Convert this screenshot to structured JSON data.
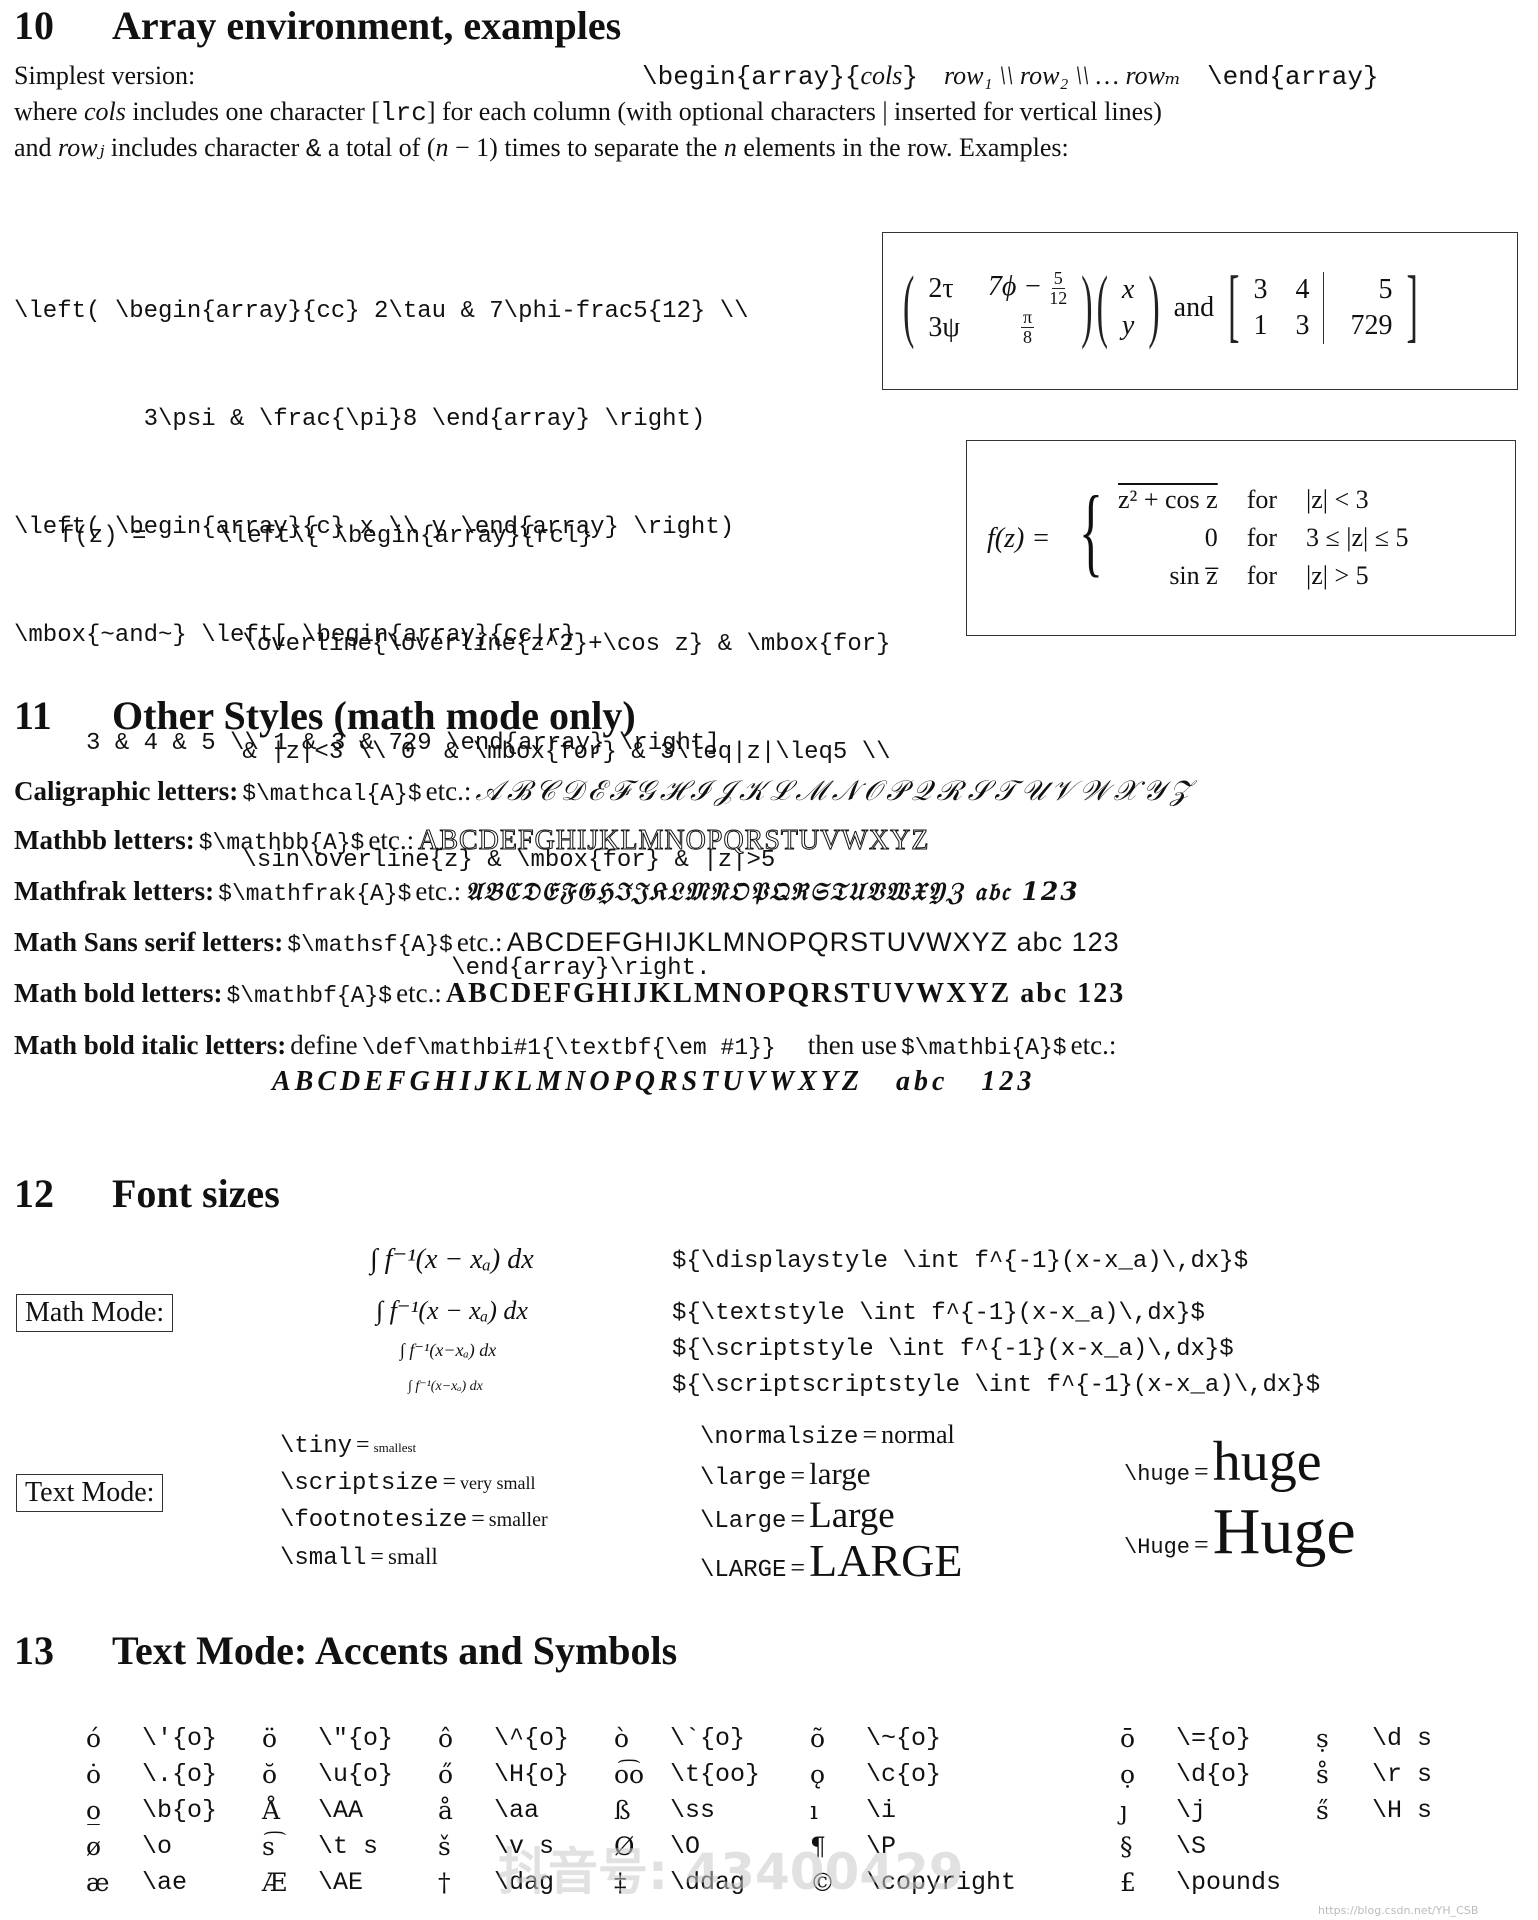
{
  "sections": {
    "s10": {
      "number": "10",
      "title": "Array environment, examples"
    },
    "s11": {
      "number": "11",
      "title": "Other Styles (math mode only)"
    },
    "s12": {
      "number": "12",
      "title": "Font sizes"
    },
    "s13": {
      "number": "13",
      "title": "Text Mode: Accents and Symbols"
    }
  },
  "array_intro": {
    "simplest_label": "Simplest version:",
    "syntax_begin": "\\begin{array}{",
    "syntax_cols": "cols",
    "syntax_close": "}",
    "syntax_rows": "row₁ \\\\ row₂ \\\\ … rowₘ",
    "syntax_end": "\\end{array}",
    "line2_a": "where ",
    "line2_cols": "cols",
    "line2_b": " includes one character [",
    "line2_lrc": "lrc",
    "line2_c": "] for each column (with optional characters | inserted for vertical lines)",
    "line3_a": "and ",
    "line3_row": "rowⱼ",
    "line3_b": " includes character ",
    "line3_amp": "&",
    "line3_c": " a total of (",
    "line3_n1": "n",
    "line3_d": " − 1) times to separate the ",
    "line3_n2": "n",
    "line3_e": " elements in the row. Examples:"
  },
  "example1": {
    "code": [
      "\\left( \\begin{array}{cc} 2\\tau & 7\\phi-frac5{12} \\\\",
      "         3\\psi & \\frac{\\pi}8 \\end{array} \\right)",
      "\\left( \\begin{array}{c} x \\\\ y \\end{array} \\right)",
      "\\mbox{~and~} \\left[ \\begin{array}{cc|r}",
      "     3 & 4 & 5 \\\\ 1 & 3 & 729 \\end{array} \\right]"
    ],
    "rendered": {
      "m1": {
        "r1c1": "2τ",
        "r1c2": "7ϕ −",
        "r1c2_num": "5",
        "r1c2_den": "12",
        "r2c1": "3ψ",
        "r2c2_num": "π",
        "r2c2_den": "8"
      },
      "m2": {
        "r1": "x",
        "r2": "y"
      },
      "and": "and",
      "m3": {
        "rows": [
          [
            "3",
            "4",
            "5"
          ],
          [
            "1",
            "3",
            "729"
          ]
        ]
      }
    }
  },
  "example2": {
    "code": [
      "f(z) =     \\left\\{ \\begin{array}{rcl}",
      "      \\overline{\\overline{z^2}+\\cos z} & \\mbox{for}",
      "      & |z|<3 \\\\ 0  & \\mbox{for} & 3\\leq|z|\\leq5 \\\\",
      "      \\sin\\overline{z} & \\mbox{for} & |z|>5",
      "             \\end{array}\\right."
    ],
    "rendered": {
      "lhs": "f(z) =",
      "rows": [
        {
          "expr": "z² + cos z",
          "for": "for",
          "cond": "|z| < 3"
        },
        {
          "expr": "0",
          "for": "for",
          "cond": "3 ≤ |z| ≤ 5"
        },
        {
          "expr": "sin z̅",
          "for": "for",
          "cond": "|z| > 5"
        }
      ]
    }
  },
  "styles": [
    {
      "label": "Caligraphic letters:",
      "cmd": "$\\mathcal{A}$",
      "etc": "etc.:",
      "sample": "𝒜ℬ𝒞𝒟ℰℱ𝒢ℋℐ𝒥𝒦ℒℳ𝒩𝒪𝒫𝒬ℛ𝒮𝒯𝒰𝒱𝒲𝒳𝒴𝒵"
    },
    {
      "label": "Mathbb letters:",
      "cmd": "$\\mathbb{A}$",
      "etc": "etc.:",
      "sample": "ABCDEFGHIJKLMNOPQRSTUVWXYZ"
    },
    {
      "label": "Mathfrak letters:",
      "cmd": "$\\mathfrak{A}$",
      "etc": "etc.:",
      "sample": "𝔄𝔅ℭ𝔇𝔈𝔉𝔊ℌℑ𝔍𝔎𝔏𝔐𝔑𝔒𝔓𝔔ℜ𝔖𝔗𝔘𝔙𝔚𝔛𝔜ℨ 𝔞𝔟𝔠 123"
    },
    {
      "label": "Math Sans serif letters:",
      "cmd": "$\\mathsf{A}$",
      "etc": "etc.:",
      "sample": "ABCDEFGHIJKLMNOPQRSTUVWXYZ abc 123"
    },
    {
      "label": "Math bold letters:",
      "cmd": "$\\mathbf{A}$",
      "etc": "etc.:",
      "sample": "ABCDEFGHIJKLMNOPQRSTUVWXYZ abc 123"
    }
  ],
  "bold_italic": {
    "label": "Math bold italic letters:",
    "define": "define",
    "def_cmd": "\\def\\mathbi#1{\\textbf{\\em #1}}",
    "then_use": "then use",
    "use_cmd": "$\\mathbi{A}$",
    "etc": "etc.:",
    "sample": "ABCDEFGHIJKLMNOPQRSTUVWXYZ   abc   123"
  },
  "font_sizes": {
    "math_mode_label": "Math Mode:",
    "math_rows": [
      {
        "rendered": "∫ f⁻¹(x − xₐ) dx",
        "code": "${\\displaystyle \\int f^{-1}(x-x_a)\\,dx}$"
      },
      {
        "rendered": "∫ f⁻¹(x − xₐ) dx",
        "code": "${\\textstyle \\int f^{-1}(x-x_a)\\,dx}$"
      },
      {
        "rendered": "∫ f⁻¹(x−xₐ) dx",
        "code": "${\\scriptstyle \\int f^{-1}(x-x_a)\\,dx}$"
      },
      {
        "rendered": "∫ f⁻¹(x−xₐ) dx",
        "code": "${\\scriptscriptstyle \\int f^{-1}(x-x_a)\\,dx}$"
      }
    ],
    "text_mode_label": "Text Mode:",
    "text_col1": [
      {
        "cmd": "\\tiny",
        "eq": "=",
        "sample": "smallest"
      },
      {
        "cmd": "\\scriptsize",
        "eq": "=",
        "sample": "very small"
      },
      {
        "cmd": "\\footnotesize",
        "eq": "=",
        "sample": "smaller"
      },
      {
        "cmd": "\\small",
        "eq": "=",
        "sample": "small"
      }
    ],
    "text_col2": [
      {
        "cmd": "\\normalsize",
        "eq": "=",
        "sample": "normal"
      },
      {
        "cmd": "\\large",
        "eq": "=",
        "sample": "large"
      },
      {
        "cmd": "\\Large",
        "eq": "=",
        "sample": "Large"
      },
      {
        "cmd": "\\LARGE",
        "eq": "=",
        "sample": "LARGE"
      }
    ],
    "text_col3": [
      {
        "cmd": "\\huge",
        "eq": "=",
        "sample": "huge"
      },
      {
        "cmd": "\\Huge",
        "eq": "=",
        "sample": "Huge"
      }
    ]
  },
  "accents": {
    "rows": [
      [
        [
          "ó",
          "\\'{o}"
        ],
        [
          "ö",
          "\\\"{o}"
        ],
        [
          "ô",
          "\\^{o}"
        ],
        [
          "ò",
          "\\`{o}"
        ],
        [
          "õ",
          "\\~{o}"
        ],
        [
          "ō",
          "\\={o}"
        ],
        [
          "ṣ",
          "\\d s"
        ]
      ],
      [
        [
          "ȯ",
          "\\.{o}"
        ],
        [
          "ŏ",
          "\\u{o}"
        ],
        [
          "ő",
          "\\H{o}"
        ],
        [
          "o͡o",
          "\\t{oo}"
        ],
        [
          "ǫ",
          "\\c{o}"
        ],
        [
          "ọ",
          "\\d{o}"
        ],
        [
          "s̊",
          "\\r s"
        ]
      ],
      [
        [
          "o̲",
          "\\b{o}"
        ],
        [
          "Å",
          "\\AA"
        ],
        [
          "å",
          "\\aa"
        ],
        [
          "ß",
          "\\ss"
        ],
        [
          "ı",
          "\\i"
        ],
        [
          "ȷ",
          "\\j"
        ],
        [
          "s̋",
          "\\H s"
        ]
      ],
      [
        [
          "ø",
          "\\o"
        ],
        [
          "s͡",
          "\\t s"
        ],
        [
          "š",
          "\\v s"
        ],
        [
          "Ø",
          "\\O"
        ],
        [
          "¶",
          "\\P"
        ],
        [
          "§",
          "\\S"
        ],
        [
          "",
          ""
        ]
      ],
      [
        [
          "æ",
          "\\ae"
        ],
        [
          "Æ",
          "\\AE"
        ],
        [
          "†",
          "\\dag"
        ],
        [
          "‡",
          "\\ddag"
        ],
        [
          "©",
          "\\copyright"
        ],
        [
          "£",
          "\\pounds"
        ],
        [
          "",
          ""
        ]
      ]
    ]
  },
  "watermark": {
    "text": "抖音号: 43400429",
    "url": "https://blog.csdn.net/YH_CSB"
  }
}
